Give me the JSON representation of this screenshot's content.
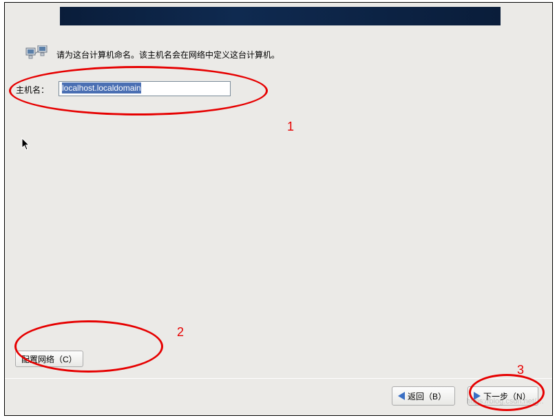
{
  "instruction": "请为这台计算机命名。该主机名会在网络中定义这台计算机。",
  "hostname": {
    "label": "主机名：",
    "value": "localhost.localdomain"
  },
  "buttons": {
    "configure_network": "配置网络（C）",
    "back": "返回（B）",
    "next": "下一步（N）"
  },
  "annotations": {
    "num1": "1",
    "num2": "2",
    "num3": "3"
  },
  "watermark": "https://blog.csdn.net/…"
}
